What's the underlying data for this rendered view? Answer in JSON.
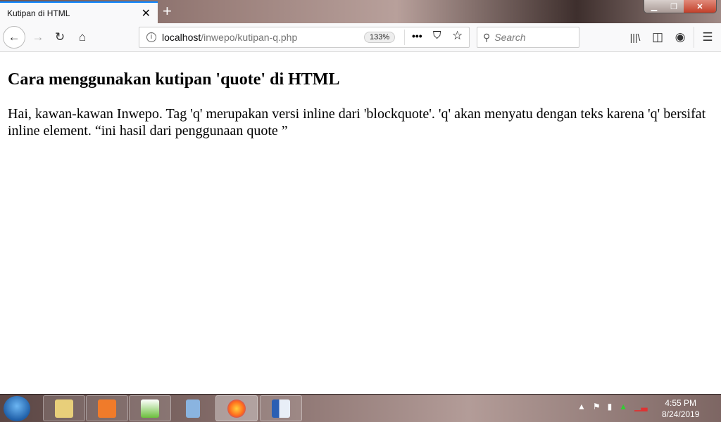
{
  "browser": {
    "tab_title": "Kutipan di HTML",
    "tab_close": "✕",
    "new_tab": "+",
    "url_host": "localhost",
    "url_path": "/inwepo/kutipan-q.php",
    "zoom_level": "133%",
    "search_placeholder": "Search",
    "accent_color": "#0a84ff"
  },
  "page": {
    "heading": "Cara menggunakan kutipan 'quote' di HTML",
    "paragraph": "Hai, kawan-kawan Inwepo. Tag 'q' merupakan versi inline dari 'blockquote'. 'q' akan menyatu dengan teks karena 'q' bersifat inline element. “ini hasil dari penggunaan quote ”"
  },
  "taskbar": {
    "apps": [
      "windows-explorer",
      "xampp",
      "notepad-plus-plus",
      "calculator",
      "firefox",
      "microsoft-word"
    ],
    "time": "4:55 PM",
    "date": "8/24/2019"
  }
}
